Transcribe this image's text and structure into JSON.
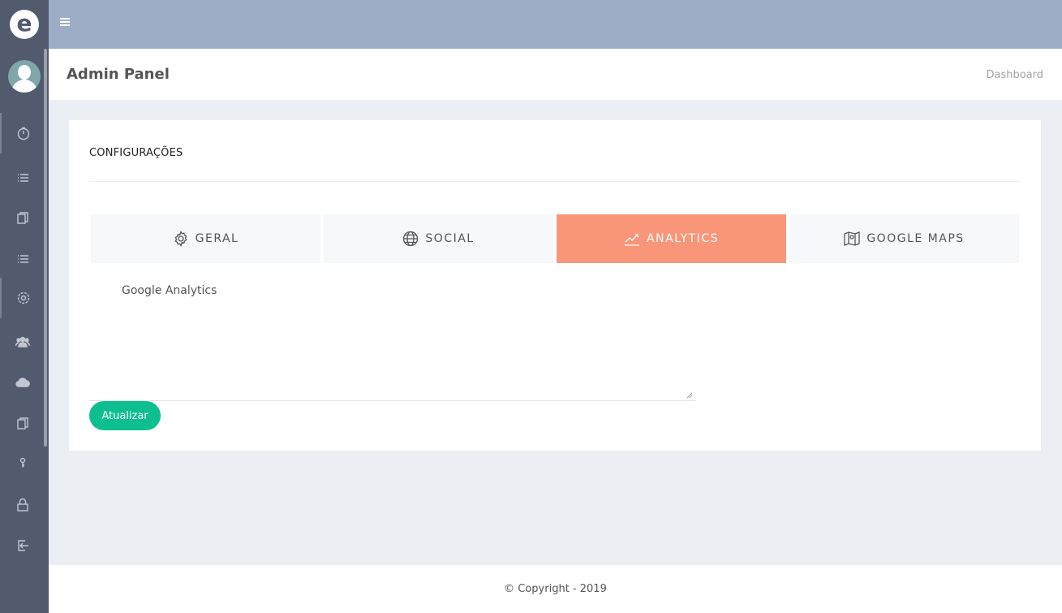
{
  "header": {
    "title": "Admin Panel",
    "breadcrumb": "Dashboard"
  },
  "card": {
    "title": "CONFIGURAÇÕES"
  },
  "tabs": [
    {
      "label": "GERAL",
      "icon": "gear-icon",
      "active": false
    },
    {
      "label": "SOCIAL",
      "icon": "globe-icon",
      "active": false
    },
    {
      "label": "ANALYTICS",
      "icon": "chart-line-icon",
      "active": true
    },
    {
      "label": "GOOGLE MAPS",
      "icon": "map-icon",
      "active": false
    }
  ],
  "analytics": {
    "field_label": "Google Analytics",
    "value": ""
  },
  "actions": {
    "update_label": "Atualizar"
  },
  "footer": {
    "text": "© Copyright - 2019"
  },
  "sidebar": {
    "items": [
      {
        "icon": "dashboard-icon"
      },
      {
        "icon": "list-icon"
      },
      {
        "icon": "pages-icon"
      },
      {
        "icon": "list-icon"
      },
      {
        "icon": "settings-icon"
      },
      {
        "icon": "users-icon"
      },
      {
        "icon": "cloud-icon"
      },
      {
        "icon": "pages-icon"
      },
      {
        "icon": "key-icon"
      },
      {
        "icon": "lock-icon"
      },
      {
        "icon": "logout-icon"
      }
    ]
  },
  "colors": {
    "sidebar": "#525a6e",
    "topbar": "#9eadc6",
    "tab_active": "#f9967a",
    "button": "#0dbf8f"
  }
}
